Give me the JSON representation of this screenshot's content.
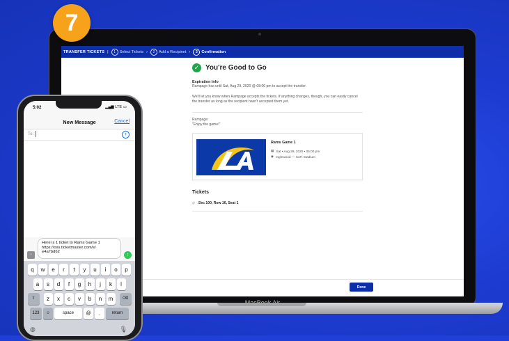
{
  "step_badge": "7",
  "laptop": {
    "brand_label": "MacBook Air",
    "topbar": {
      "title": "TRANSFER TICKETS",
      "separator": "|",
      "steps": [
        {
          "num": "1",
          "label": "Select Tickets"
        },
        {
          "num": "2",
          "label": "Add a Recipient"
        },
        {
          "num": "3",
          "label": "Confirmation"
        }
      ],
      "chevron": "›"
    },
    "main": {
      "heading": "You're Good to Go",
      "expiration_label": "Expiration Info",
      "expiration_text": "Rampage has until Sat, Aug 29, 2020 @ 08:00 pm to accept the transfer.",
      "notice_text": "We'll let you know when Rampage accepts the tickets. If anything changes, though, you can easily cancel the transfer as long as the recipient hasn't accepted them yet.",
      "recipient": "Rampage:",
      "message": "\"Enjoy the game!\"",
      "event": {
        "name": "Rams Game 1",
        "datetime": "Sat • Aug 29, 2020 • 06:00 pm",
        "venue": "Inglewood — SoFi Stadium",
        "logo_text": "LA"
      },
      "tickets_heading": "Tickets",
      "seat": "Sec 100, Row 16, Seat 1"
    },
    "done_label": "Done"
  },
  "phone": {
    "time": "5:02",
    "signal": "LTE",
    "title": "New Message",
    "cancel_label": "Cancel",
    "to_label": "To:",
    "message_text": "Here is 1 ticket to Rams Game 1\nhttps://oss.ticketmaster.com/s/\ne4a7bd62",
    "keyboard": {
      "row1": [
        "q",
        "w",
        "e",
        "r",
        "t",
        "y",
        "u",
        "i",
        "o",
        "p"
      ],
      "row2": [
        "a",
        "s",
        "d",
        "f",
        "g",
        "h",
        "j",
        "k",
        "l"
      ],
      "row3": [
        "z",
        "x",
        "c",
        "v",
        "b",
        "n",
        "m"
      ],
      "numbers_label": "123",
      "space_label": "space",
      "at_label": "@",
      "dot_label": ".",
      "return_label": "return"
    }
  },
  "colors": {
    "background": "#1f3fd6",
    "badge": "#f7a21b",
    "ticketmaster_blue": "#0d2ea8",
    "success_green": "#1fa64a"
  }
}
